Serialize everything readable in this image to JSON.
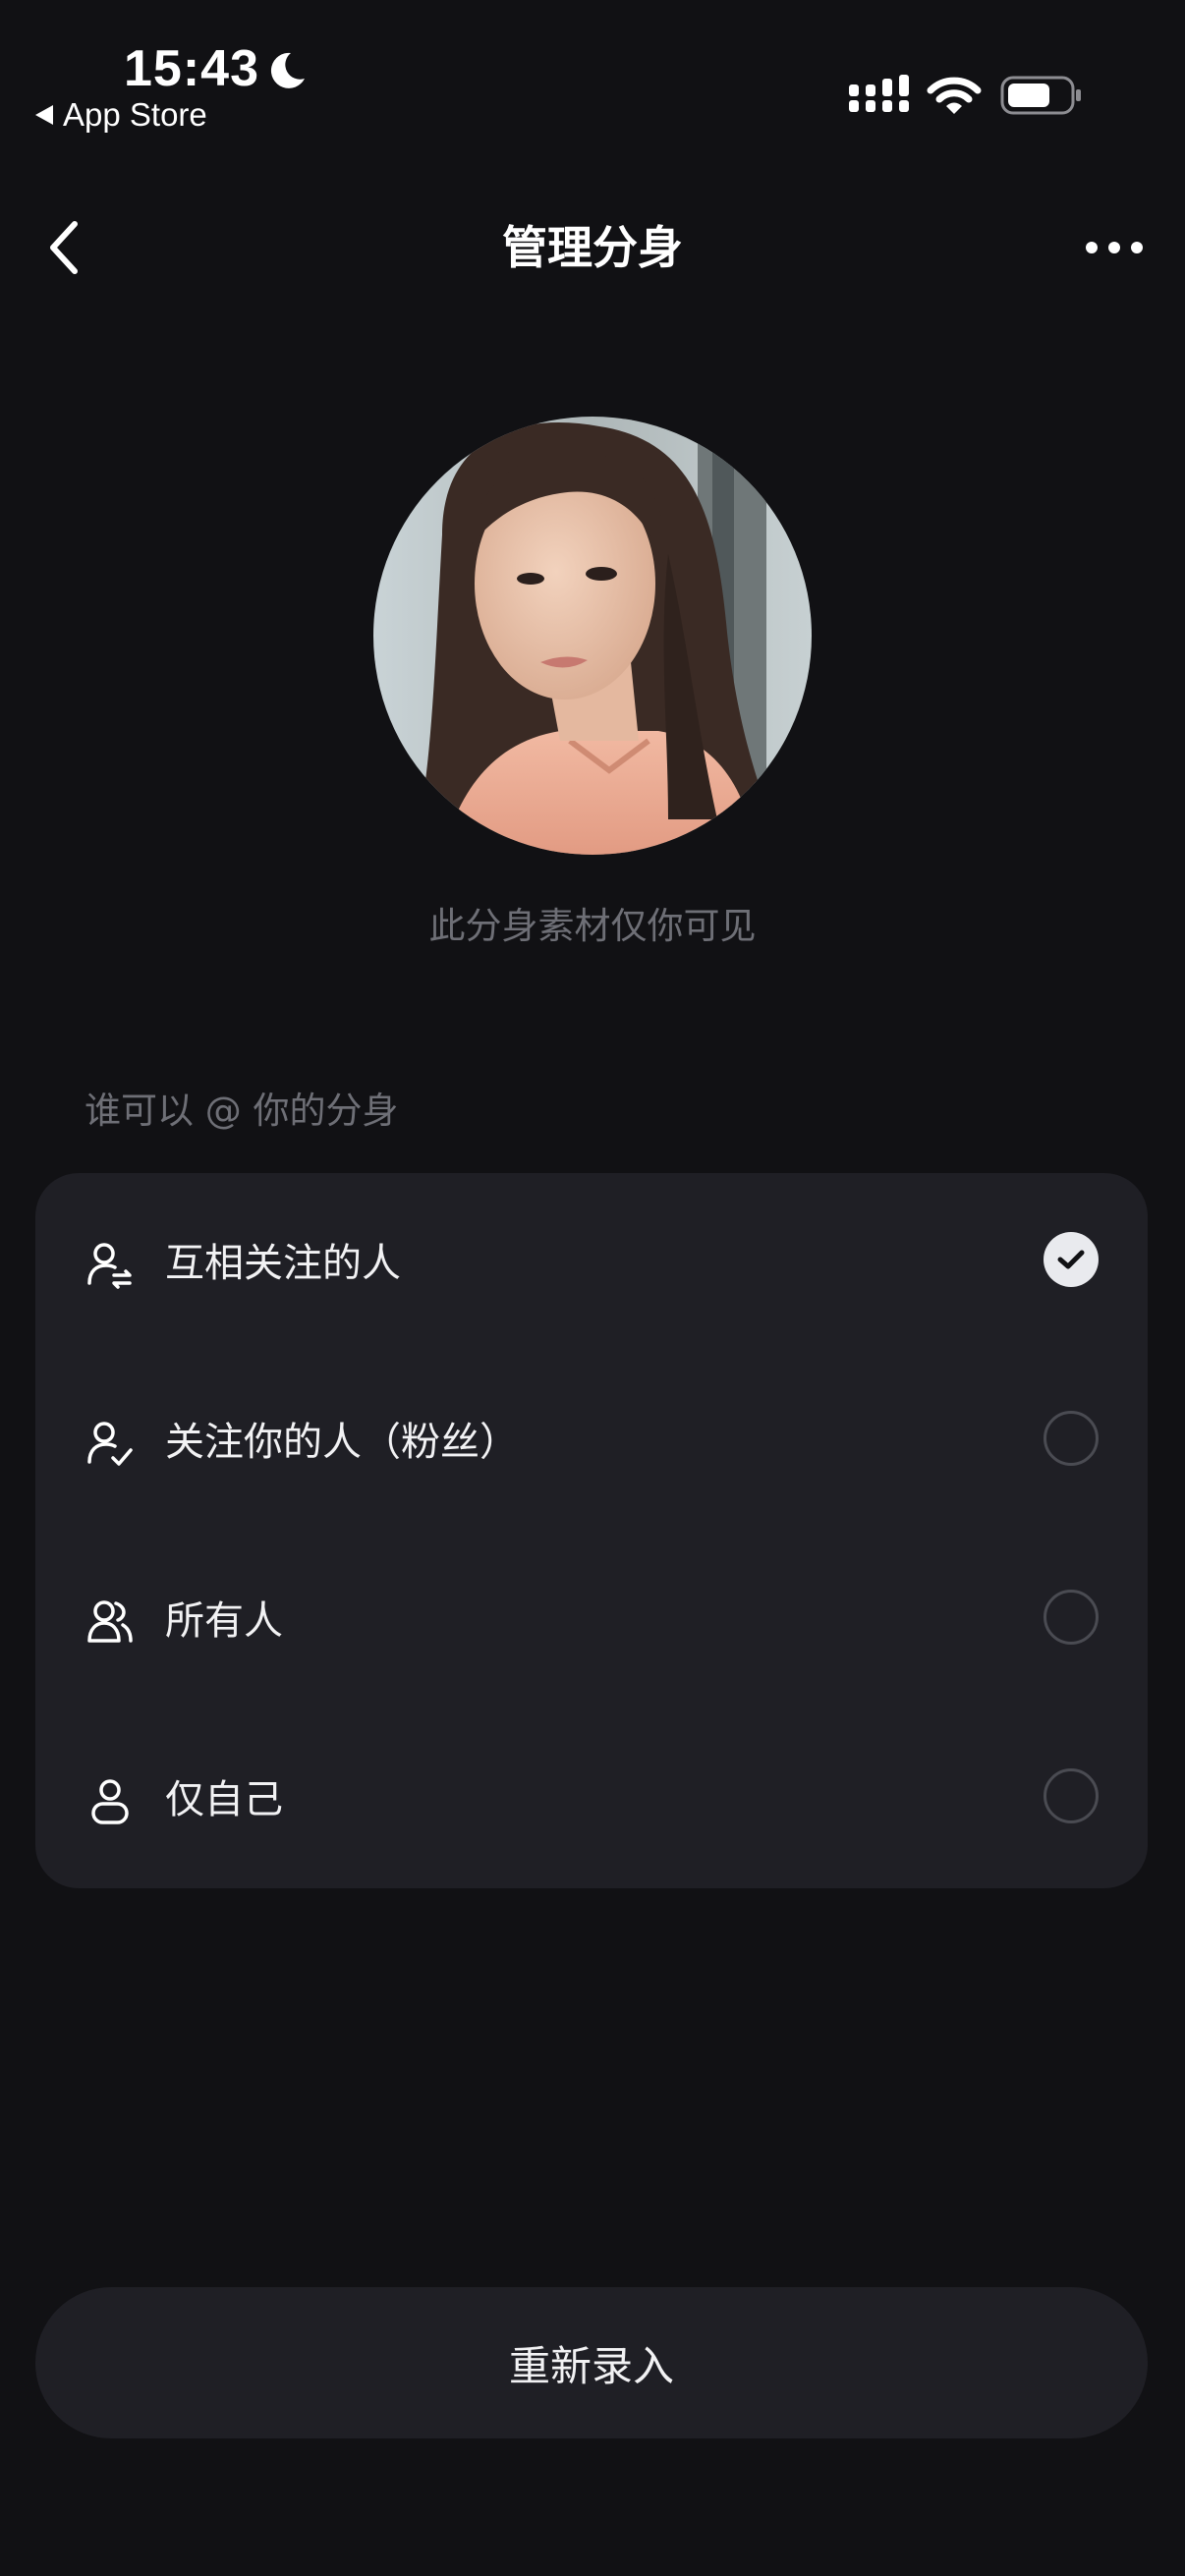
{
  "status_bar": {
    "time": "15:43",
    "back_to_app": "App Store"
  },
  "nav": {
    "title": "管理分身"
  },
  "avatar": {
    "note": "此分身素材仅你可见"
  },
  "mention_settings": {
    "label": "谁可以 @ 你的分身",
    "options": [
      {
        "label": "互相关注的人",
        "icon": "mutual-follow-icon",
        "selected": true
      },
      {
        "label": "关注你的人（粉丝）",
        "icon": "follower-icon",
        "selected": false
      },
      {
        "label": "所有人",
        "icon": "everyone-icon",
        "selected": false
      },
      {
        "label": "仅自己",
        "icon": "self-icon",
        "selected": false
      }
    ]
  },
  "actions": {
    "re_record_label": "重新录入"
  }
}
